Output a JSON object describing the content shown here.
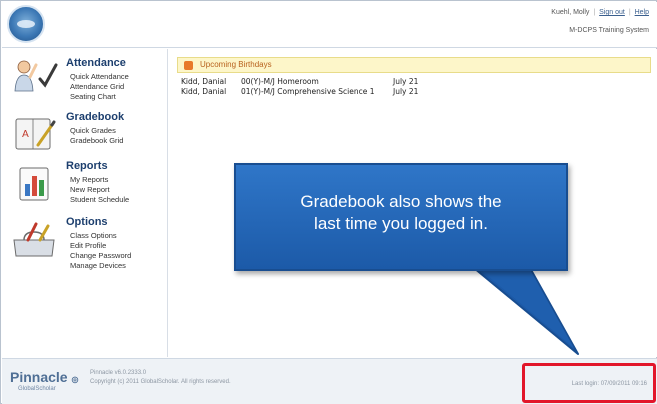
{
  "header": {
    "user_name": "Kuehl, Molly",
    "sign_out": "Sign out",
    "help": "Help",
    "system_name": "M-DCPS Training System"
  },
  "sidebar": {
    "groups": [
      {
        "title": "Attendance",
        "icon": "attendance-icon",
        "items": [
          "Quick Attendance",
          "Attendance Grid",
          "Seating Chart"
        ]
      },
      {
        "title": "Gradebook",
        "icon": "gradebook-icon",
        "items": [
          "Quick Grades",
          "Gradebook Grid"
        ]
      },
      {
        "title": "Reports",
        "icon": "reports-icon",
        "items": [
          "My Reports",
          "New Report",
          "Student Schedule"
        ]
      },
      {
        "title": "Options",
        "icon": "toolbox-icon",
        "items": [
          "Class Options",
          "Edit Profile",
          "Change Password",
          "Manage Devices"
        ]
      }
    ]
  },
  "main": {
    "birthdays": {
      "title": "Upcoming Birthdays",
      "rows": [
        {
          "name": "Kidd, Danial",
          "class": "00(Y)-M/J Homeroom",
          "date": "July 21"
        },
        {
          "name": "Kidd, Danial",
          "class": "01(Y)-M/J Comprehensive Science 1",
          "date": "July 21"
        }
      ]
    }
  },
  "callout": {
    "line1": "Gradebook also shows the",
    "line2": "last time you logged in."
  },
  "footer": {
    "brand": "Pinnacle",
    "brand_sub": "GlobalScholar",
    "version": "Pinnacle v6.0.2333.0",
    "copyright": "Copyright (c) 2011 GlobalScholar. All rights reserved.",
    "last_login": "Last login: 07/09/2011 09:16"
  },
  "colors": {
    "callout_fill": "#1f63b3",
    "highlight": "#e2162a",
    "nav_title": "#1d3f6e",
    "birthday_bar": "#fdf6c9"
  }
}
